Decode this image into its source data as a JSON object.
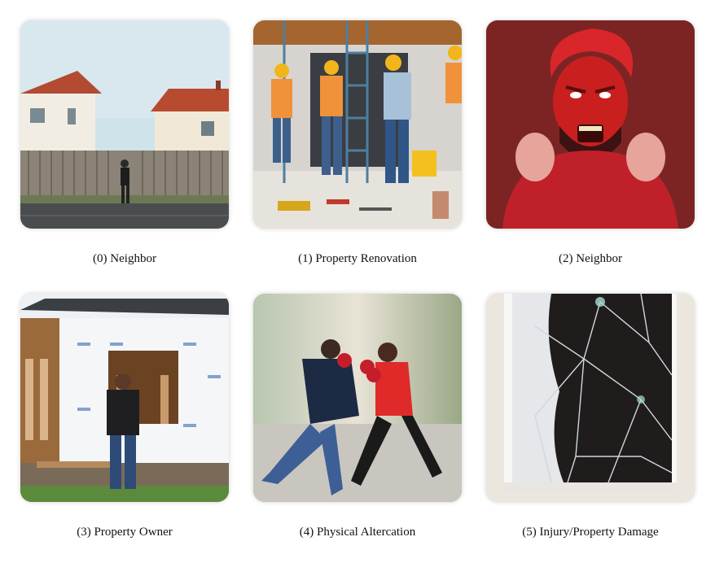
{
  "panels": [
    {
      "caption": "(0) Neighbor",
      "illustration": "neighbor-by-fence"
    },
    {
      "caption": "(1) Property Renovation",
      "illustration": "construction-workers"
    },
    {
      "caption": "(2) Neighbor",
      "illustration": "angry-red-man"
    },
    {
      "caption": "(3) Property Owner",
      "illustration": "man-facing-house-under-construction"
    },
    {
      "caption": "(4) Physical Altercation",
      "illustration": "two-people-fighting"
    },
    {
      "caption": "(5) Injury/Property Damage",
      "illustration": "broken-window"
    }
  ]
}
